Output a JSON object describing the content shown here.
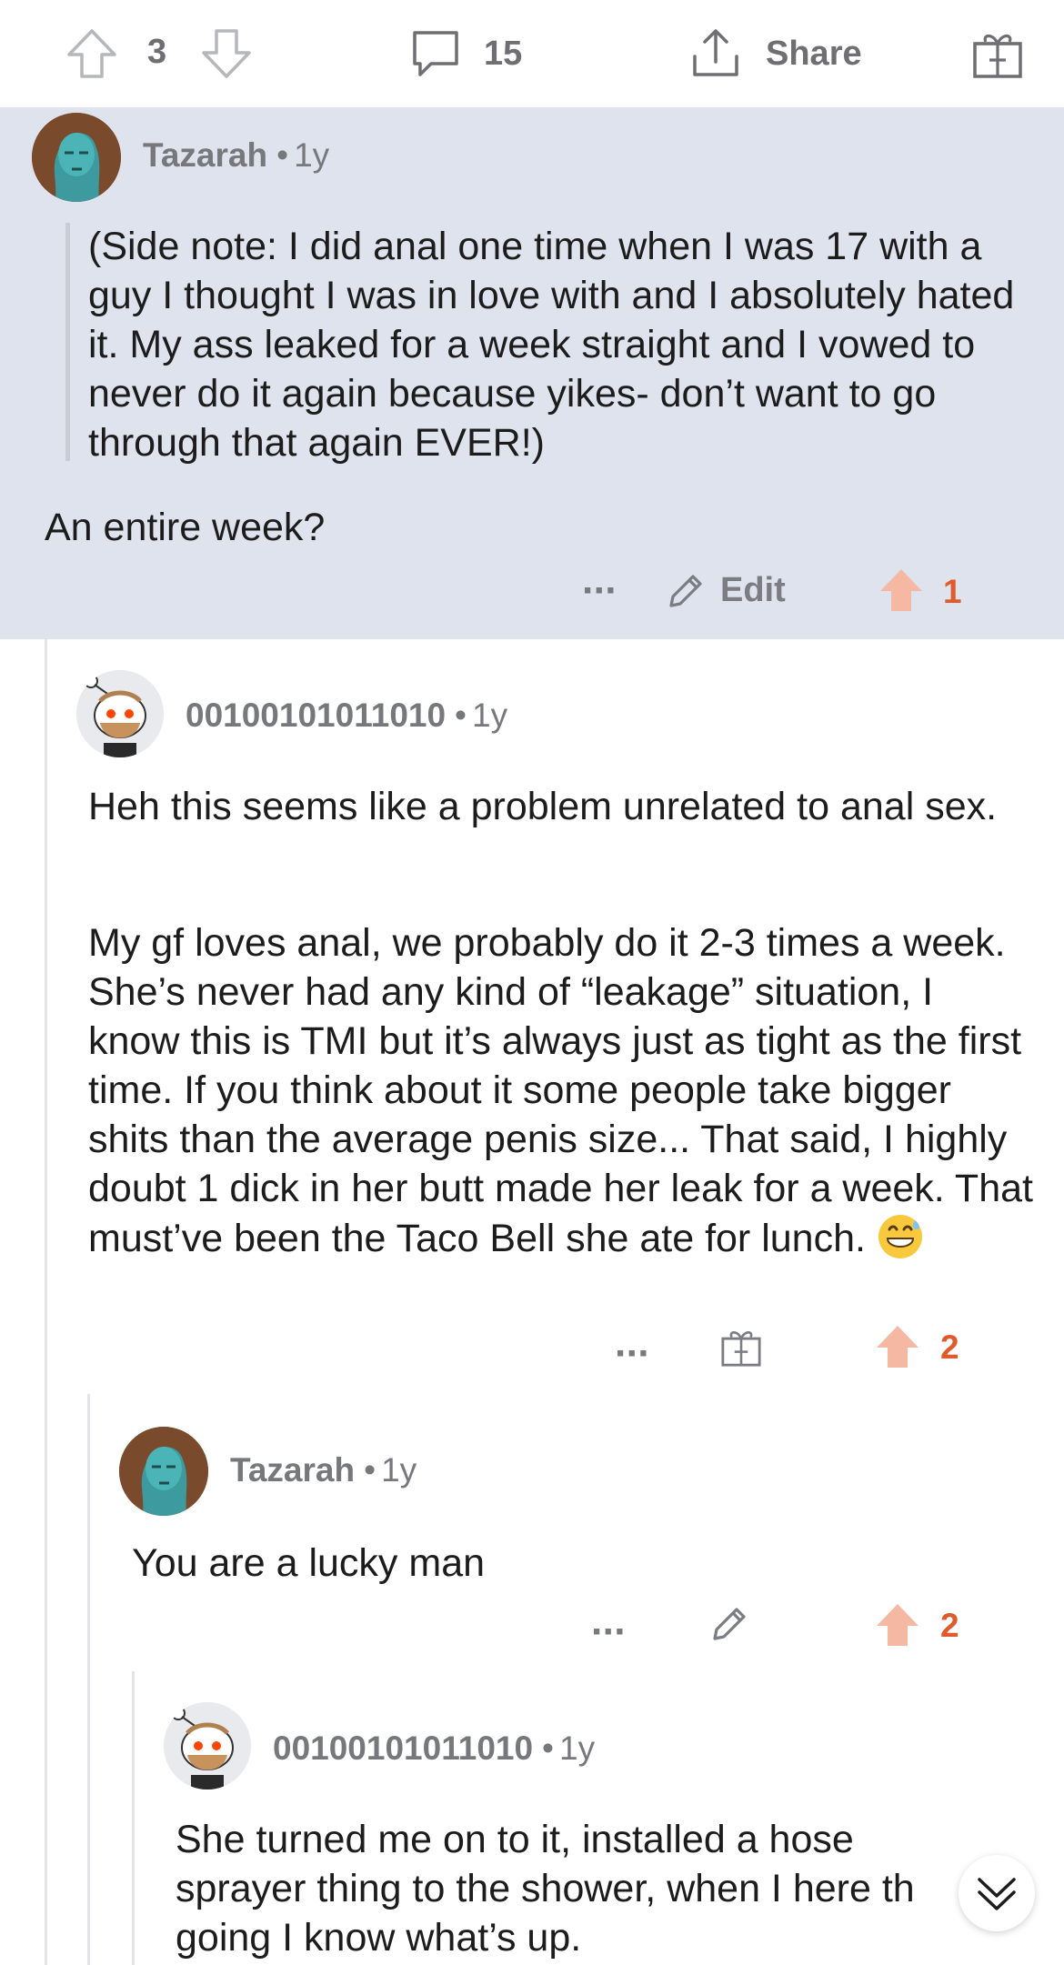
{
  "top_bar": {
    "upvote_count": "3",
    "comment_count": "15",
    "share_label": "Share"
  },
  "comments": [
    {
      "author": "Tazarah",
      "age": "1y",
      "quote": "(Side note: I did anal one time when I was 17 with a guy I thought I was in love with and I absolutely hated it. My ass leaked for a week straight and I vowed to never do it again because yikes- don’t want to go through that again EVER!)",
      "text": "An entire week?",
      "edit_label": "Edit",
      "votes": "1"
    },
    {
      "author": "00100101011010",
      "age": "1y",
      "para1": "Heh this seems like a problem unrelated to anal sex.",
      "para2": "My gf loves anal, we probably do it 2-3 times a week. She’s never had any kind of “leakage” situation, I know this is TMI but it’s always just as tight as the first time. If you think about it some people take bigger shits than the average penis size... That said, I highly doubt 1 dick in her butt made her leak for a week. That must’ve been the Taco Bell she ate for lunch.",
      "votes": "2"
    },
    {
      "author": "Tazarah",
      "age": "1y",
      "text": "You are a lucky man",
      "votes": "2"
    },
    {
      "author": "00100101011010",
      "age": "1y",
      "text_line1": "She turned me on to it, installed a hose",
      "text_line2": "sprayer thing to the shower, when I here th",
      "text_line3": "going I know what’s up."
    }
  ],
  "colors": {
    "highlight_bg": "#dfe3ee",
    "vote_orange": "#e05a2b",
    "upvote_arrow": "#f4b8a3"
  },
  "icons": {
    "upvote": "arrow-up-icon",
    "downvote": "arrow-down-icon",
    "comment": "speech-bubble-icon",
    "share": "share-icon",
    "award": "gift-icon",
    "more": "more-dots-icon",
    "edit": "pencil-icon",
    "scroll": "double-chevron-down-icon"
  }
}
